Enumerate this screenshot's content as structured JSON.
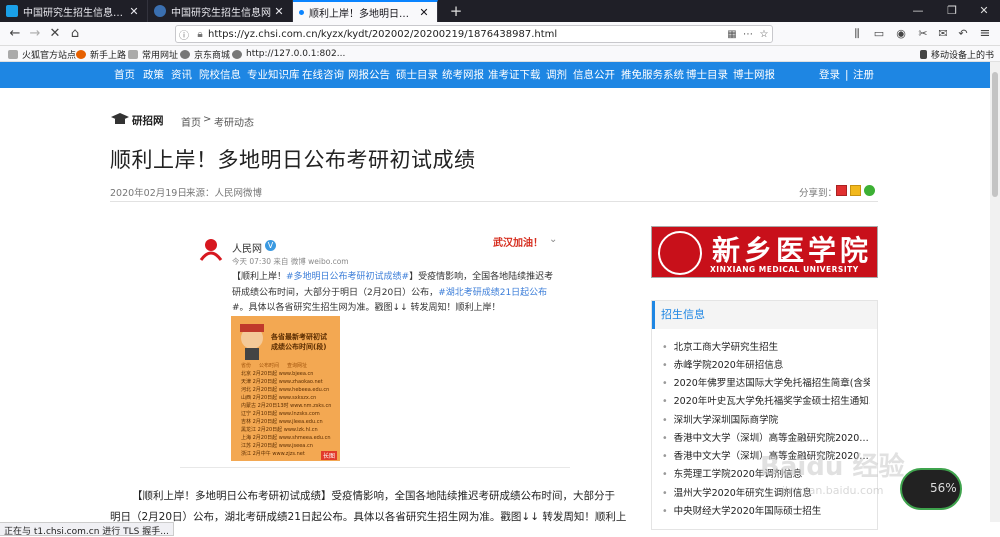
{
  "tabs": [
    {
      "label": "中国研究生招生信息网 - 国内最权威",
      "active": false
    },
    {
      "label": "中国研究生招生信息网",
      "active": false
    },
    {
      "label": "顺利上岸！多地明日公布考研初试",
      "active": true
    }
  ],
  "url": "https://yz.chsi.com.cn/kyzx/kydt/202002/20200219/1876438987.html",
  "bookmarks": [
    "火狐官方站点",
    "新手上路",
    "常用网址",
    "京东商城",
    "http://127.0.0.1:802...",
    "移动设备上的书"
  ],
  "site_nav": {
    "items": [
      "首页",
      "政策",
      "资讯",
      "院校信息",
      "专业知识库",
      "在线咨询",
      "网报公告",
      "硕士目录",
      "统考网报",
      "准考证下载",
      "调剂",
      "信息公开",
      "推免服务系统",
      "博士目录",
      "博士网报"
    ],
    "login": "登录",
    "sep": "|",
    "register": "注册"
  },
  "breadcrumb": {
    "brand": "研招网",
    "home": "首页",
    "sep": ">",
    "section": "考研动态"
  },
  "article": {
    "title": "顺利上岸！多地明日公布考研初试成绩",
    "date": "2020年02月19日",
    "source": "来源：人民网微博",
    "share_label": "分享到："
  },
  "weibo": {
    "user": "人民网",
    "badge": "V",
    "meta": "今天 07:30 来自 微博 weibo.com",
    "stamp": "武汉加油！",
    "line1_a": "【顺利上岸！",
    "line1_tag": "#多地明日公布考研初试成绩#",
    "line1_b": "】受疫情影响，全国各地陆续推迟考",
    "line2": "研成绩公布时间，大部分于明日（2月20日）公布，",
    "line2_tag": "#湖北考研成绩21日起公布",
    "line3": "#。具体以各省研究生招生网为准。戳图↓↓ 转发周知！顺利上岸！",
    "poster_title1": "各省最新考研初试",
    "poster_title2": "成绩公布时间(段)",
    "poster_cols": [
      "省份",
      "公布时间",
      "查询网址"
    ],
    "poster_rows": [
      [
        "北京",
        "2月20日起",
        "www.bjeea.cn"
      ],
      [
        "天津",
        "2月20日起",
        "www.zhaokao.net"
      ],
      [
        "河北",
        "2月20日起",
        "www.hebeea.edu.cn"
      ],
      [
        "山西",
        "2月20日起",
        "www.sxkszx.cn"
      ],
      [
        "内蒙古",
        "2月20日13时",
        "www.nm.zsks.cn"
      ],
      [
        "辽宁",
        "2月10日起",
        "www.lnzsks.com"
      ],
      [
        "吉林",
        "2月20日起",
        "www.jleea.edu.cn"
      ],
      [
        "黑龙江",
        "2月20日起",
        "www.lzk.hl.cn"
      ],
      [
        "上海",
        "2月20日起",
        "www.shmeea.edu.cn"
      ],
      [
        "江苏",
        "2月20日起",
        "www.jseea.cn"
      ],
      [
        "浙江",
        "2月中午",
        "www.zjzs.net"
      ]
    ],
    "poster_more": "长图"
  },
  "body_lines": [
    "【顺利上岸！多地明日公布考研初试成绩】受疫情影响，全国各地陆续推迟考研成绩公布时间，大部分于",
    "明日（2月20日）公布，湖北考研成绩21日起公布。具体以各省研究生招生网为准。戳图↓↓ 转发周知！顺利上"
  ],
  "ad": {
    "cn": "新乡医学院",
    "en": "XINXIANG MEDICAL UNIVERSITY"
  },
  "sidebar": {
    "title": "招生信息",
    "items": [
      "北京工商大学研究生招生",
      "赤峰学院2020年研招信息",
      "2020年佛罗里达国际大学免托福招生简章(含奖…",
      "2020年叶史瓦大学免托福奖学金硕士招生通知…",
      "深圳大学深圳国际商学院",
      "香港中文大学（深圳）高等金融研究院2020…",
      "香港中文大学（深圳）高等金融研究院2020…",
      "东莞理工学院2020年调剂信息",
      "温州大学2020年研究生调剂信息",
      "中央财经大学2020年国际硕士招生"
    ]
  },
  "status": "正在与 t1.chsi.com.cn 进行 TLS 握手...",
  "watermark": {
    "brand": "Baidu 经验",
    "url": "jingyan.baidu.com",
    "speed_pct": "56%"
  },
  "colors": {
    "nav_blue": "#1e86e3",
    "ad_red": "#c8101a",
    "tab_dark": "#1f1f27"
  }
}
